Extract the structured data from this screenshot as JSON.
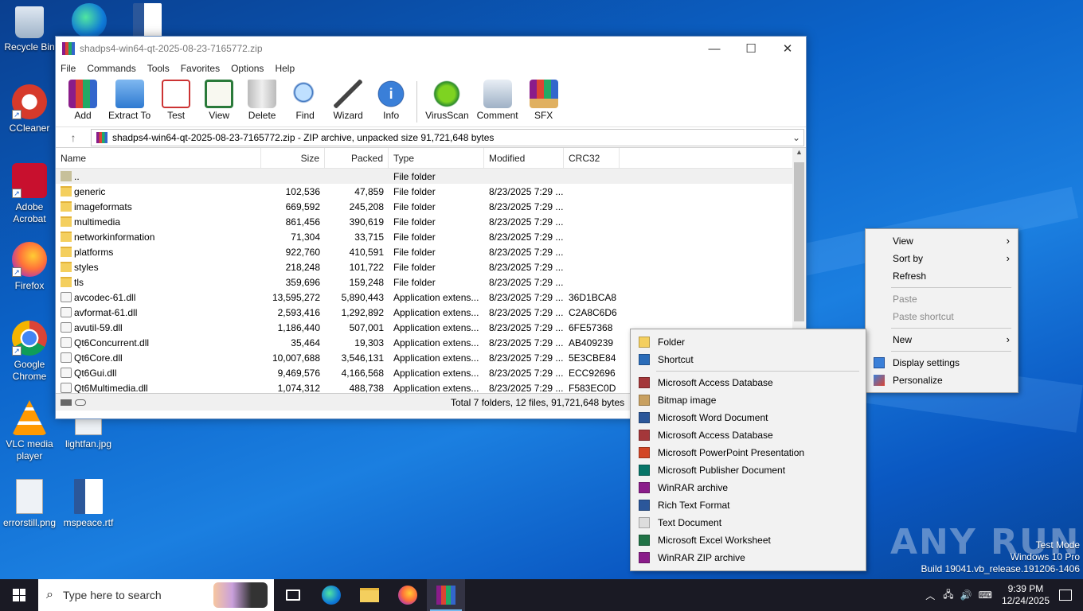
{
  "desktop": {
    "icons": [
      {
        "label": "Recycle Bin"
      },
      {
        "label": "CCleaner"
      },
      {
        "label": "Adobe Acrobat"
      },
      {
        "label": "Firefox"
      },
      {
        "label": "Google Chrome"
      },
      {
        "label": "VLC media player"
      },
      {
        "label": "lightfan.jpg"
      },
      {
        "label": "errorstill.png"
      },
      {
        "label": "mspeace.rtf"
      }
    ]
  },
  "winrar": {
    "title": "shadps4-win64-qt-2025-08-23-7165772.zip",
    "menu": [
      "File",
      "Commands",
      "Tools",
      "Favorites",
      "Options",
      "Help"
    ],
    "toolbar": [
      "Add",
      "Extract To",
      "Test",
      "View",
      "Delete",
      "Find",
      "Wizard",
      "Info",
      "VirusScan",
      "Comment",
      "SFX"
    ],
    "address": "shadps4-win64-qt-2025-08-23-7165772.zip - ZIP archive, unpacked size 91,721,648 bytes",
    "columns": [
      "Name",
      "Size",
      "Packed",
      "Type",
      "Modified",
      "CRC32"
    ],
    "rows": [
      {
        "name": "..",
        "size": "",
        "packed": "",
        "type": "File folder",
        "modified": "",
        "crc": "",
        "kind": "up"
      },
      {
        "name": "generic",
        "size": "102,536",
        "packed": "47,859",
        "type": "File folder",
        "modified": "8/23/2025 7:29 ...",
        "crc": "",
        "kind": "folder"
      },
      {
        "name": "imageformats",
        "size": "669,592",
        "packed": "245,208",
        "type": "File folder",
        "modified": "8/23/2025 7:29 ...",
        "crc": "",
        "kind": "folder"
      },
      {
        "name": "multimedia",
        "size": "861,456",
        "packed": "390,619",
        "type": "File folder",
        "modified": "8/23/2025 7:29 ...",
        "crc": "",
        "kind": "folder"
      },
      {
        "name": "networkinformation",
        "size": "71,304",
        "packed": "33,715",
        "type": "File folder",
        "modified": "8/23/2025 7:29 ...",
        "crc": "",
        "kind": "folder"
      },
      {
        "name": "platforms",
        "size": "922,760",
        "packed": "410,591",
        "type": "File folder",
        "modified": "8/23/2025 7:29 ...",
        "crc": "",
        "kind": "folder"
      },
      {
        "name": "styles",
        "size": "218,248",
        "packed": "101,722",
        "type": "File folder",
        "modified": "8/23/2025 7:29 ...",
        "crc": "",
        "kind": "folder"
      },
      {
        "name": "tls",
        "size": "359,696",
        "packed": "159,248",
        "type": "File folder",
        "modified": "8/23/2025 7:29 ...",
        "crc": "",
        "kind": "folder"
      },
      {
        "name": "avcodec-61.dll",
        "size": "13,595,272",
        "packed": "5,890,443",
        "type": "Application extens...",
        "modified": "8/23/2025 7:29 ...",
        "crc": "36D1BCA8",
        "kind": "dll"
      },
      {
        "name": "avformat-61.dll",
        "size": "2,593,416",
        "packed": "1,292,892",
        "type": "Application extens...",
        "modified": "8/23/2025 7:29 ...",
        "crc": "C2A8C6D6",
        "kind": "dll"
      },
      {
        "name": "avutil-59.dll",
        "size": "1,186,440",
        "packed": "507,001",
        "type": "Application extens...",
        "modified": "8/23/2025 7:29 ...",
        "crc": "6FE57368",
        "kind": "dll"
      },
      {
        "name": "Qt6Concurrent.dll",
        "size": "35,464",
        "packed": "19,303",
        "type": "Application extens...",
        "modified": "8/23/2025 7:29 ...",
        "crc": "AB409239",
        "kind": "dll"
      },
      {
        "name": "Qt6Core.dll",
        "size": "10,007,688",
        "packed": "3,546,131",
        "type": "Application extens...",
        "modified": "8/23/2025 7:29 ...",
        "crc": "5E3CBE84",
        "kind": "dll"
      },
      {
        "name": "Qt6Gui.dll",
        "size": "9,469,576",
        "packed": "4,166,568",
        "type": "Application extens...",
        "modified": "8/23/2025 7:29 ...",
        "crc": "ECC92696",
        "kind": "dll"
      },
      {
        "name": "Qt6Multimedia.dll",
        "size": "1,074,312",
        "packed": "488,738",
        "type": "Application extens...",
        "modified": "8/23/2025 7:29 ...",
        "crc": "F583EC0D",
        "kind": "dll"
      }
    ],
    "status": "Total 7 folders, 12 files, 91,721,648 bytes"
  },
  "desktop_menu": {
    "view": "View",
    "sort_by": "Sort by",
    "refresh": "Refresh",
    "paste": "Paste",
    "paste_shortcut": "Paste shortcut",
    "new": "New",
    "display_settings": "Display settings",
    "personalize": "Personalize"
  },
  "new_menu": [
    {
      "label": "Folder",
      "color": "#f4cf5e"
    },
    {
      "label": "Shortcut",
      "color": "#2b6cb8"
    },
    {
      "label": "Microsoft Access Database",
      "color": "#a4373a"
    },
    {
      "label": "Bitmap image",
      "color": "#c8a060"
    },
    {
      "label": "Microsoft Word Document",
      "color": "#2b579a"
    },
    {
      "label": "Microsoft Access Database",
      "color": "#a4373a"
    },
    {
      "label": "Microsoft PowerPoint Presentation",
      "color": "#d24726"
    },
    {
      "label": "Microsoft Publisher Document",
      "color": "#077568"
    },
    {
      "label": "WinRAR archive",
      "color": "#8a1c8a"
    },
    {
      "label": "Rich Text Format",
      "color": "#2b579a"
    },
    {
      "label": "Text Document",
      "color": "#dddddd"
    },
    {
      "label": "Microsoft Excel Worksheet",
      "color": "#217346"
    },
    {
      "label": "WinRAR ZIP archive",
      "color": "#8a1c8a"
    }
  ],
  "taskbar": {
    "search_placeholder": "Type here to search",
    "time": "9:39 PM",
    "date": "12/24/2025"
  },
  "watermark": {
    "line1": "Test Mode",
    "line2": "Windows 10 Pro",
    "line3": "Build 19041.vb_release.191206-1406",
    "brand": "ANY RUN"
  }
}
